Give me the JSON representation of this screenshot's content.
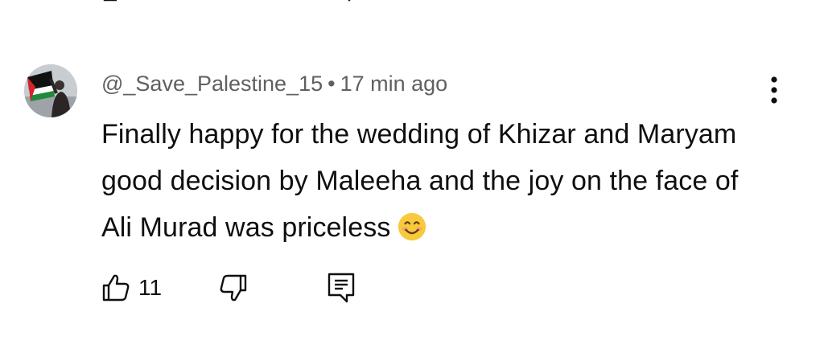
{
  "comment": {
    "author": "@_Save_Palestine_15",
    "separator": "•",
    "time": "17 min ago",
    "text_before_emoji": "Finally happy for the wedding of Khizar and Maryam good decision by Maleeha and the joy on the face of Ali Murad was priceless",
    "emoji": "smiling-face-emoji",
    "like_count": "11"
  },
  "icons": {
    "avatar": "avatar-palestine-flag",
    "menu": "more-vert-icon",
    "like": "thumbs-up-icon",
    "dislike": "thumbs-down-icon",
    "reply": "reply-comment-icon"
  },
  "colors": {
    "text_primary": "#0f0f0f",
    "text_secondary": "#606060",
    "emoji_face": "#f7c93b"
  }
}
